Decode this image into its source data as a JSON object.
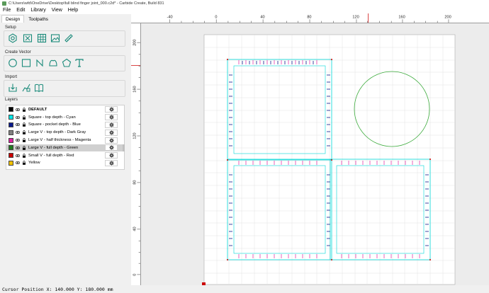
{
  "window": {
    "title": "C:\\Users\\wfd\\OneDrive\\Desktop\\full blind finger joint_000.c2d* - Carbide Create, Build 831"
  },
  "menu": [
    "File",
    "Edit",
    "Library",
    "View",
    "Help"
  ],
  "tabs": [
    "Design",
    "Toolpaths"
  ],
  "sections": {
    "setup": "Setup",
    "create_vector": "Create Vector",
    "import": "Import",
    "layers": "Layers"
  },
  "icons": {
    "setup": [
      "gear-setup-icon",
      "grid-setup-icon",
      "table-grid-icon",
      "image-icon",
      "ruler-icon"
    ],
    "create_vector": [
      "circle-icon",
      "rectangle-icon",
      "curve-icon",
      "polygon-icon",
      "pentagon-icon",
      "text-icon"
    ],
    "import": [
      "import-icon",
      "import-bitmap-icon",
      "book-icon"
    ]
  },
  "layers": [
    {
      "name": "DEFAULT",
      "color": "#000000",
      "bold": true
    },
    {
      "name": "Square - top depth - Cyan",
      "color": "#00e5e5",
      "bold": false
    },
    {
      "name": "Square - pocket depth - Blue",
      "color": "#0a1a8c",
      "bold": false
    },
    {
      "name": "Large V - top depth - Dark Gray",
      "color": "#808080",
      "bold": false
    },
    {
      "name": "Large V - half thickness - Magenta",
      "color": "#e020a0",
      "bold": false
    },
    {
      "name": "Large V - full depth - Green",
      "color": "#1f7a1f",
      "bold": false,
      "selected": true
    },
    {
      "name": "Small V - full depth - Red",
      "color": "#cc0000",
      "bold": false
    },
    {
      "name": "Yellow",
      "color": "#f0c000",
      "bold": false
    }
  ],
  "ruler": {
    "x_labels": [
      "-40",
      "0",
      "40",
      "80",
      "120",
      "160",
      "200"
    ],
    "y_labels": [
      "200",
      "160",
      "120",
      "80",
      "40",
      "0"
    ]
  },
  "status": {
    "text": "Cursor Position X: 140.000 Y: 180.000 mm"
  }
}
